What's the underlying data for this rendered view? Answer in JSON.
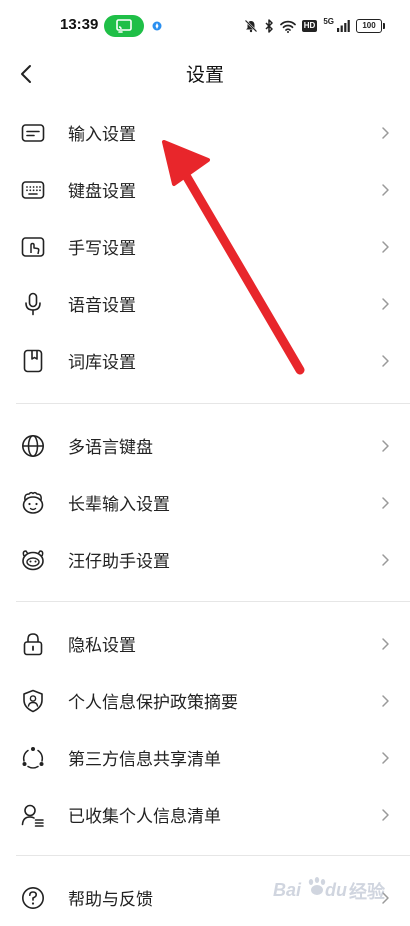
{
  "status_bar": {
    "time": "13:39",
    "hd_label": "HD",
    "network": "5G",
    "battery": "100"
  },
  "header": {
    "title": "设置"
  },
  "sections": [
    {
      "items": [
        {
          "label": "输入设置",
          "icon": "input-settings-icon"
        },
        {
          "label": "键盘设置",
          "icon": "keyboard-icon"
        },
        {
          "label": "手写设置",
          "icon": "handwriting-icon"
        },
        {
          "label": "语音设置",
          "icon": "microphone-icon"
        },
        {
          "label": "词库设置",
          "icon": "dictionary-icon"
        }
      ]
    },
    {
      "items": [
        {
          "label": "多语言键盘",
          "icon": "globe-icon"
        },
        {
          "label": "长辈输入设置",
          "icon": "elder-face-icon"
        },
        {
          "label": "汪仔助手设置",
          "icon": "dog-assistant-icon"
        }
      ]
    },
    {
      "items": [
        {
          "label": "隐私设置",
          "icon": "lock-icon"
        },
        {
          "label": "个人信息保护政策摘要",
          "icon": "shield-user-icon"
        },
        {
          "label": "第三方信息共享清单",
          "icon": "share-icon"
        },
        {
          "label": "已收集个人信息清单",
          "icon": "user-list-icon"
        }
      ]
    },
    {
      "items": [
        {
          "label": "帮助与反馈",
          "icon": "help-icon"
        }
      ]
    }
  ],
  "colors": {
    "accent_green": "#1fbf47",
    "annotation_red": "#e8262b"
  },
  "watermark_text": "Baidu 经验"
}
